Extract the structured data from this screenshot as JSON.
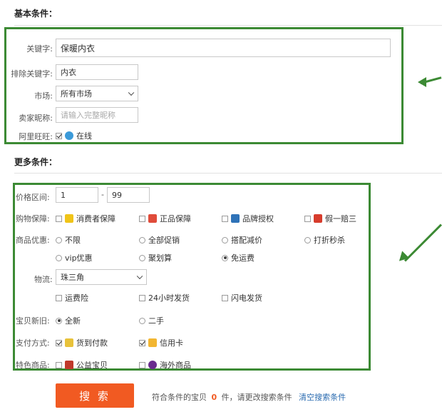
{
  "basic": {
    "title": "基本条件：",
    "keyword_label": "关键字:",
    "keyword_value": "保暖内衣",
    "exclude_label": "排除关键字:",
    "exclude_value": "内衣",
    "market_label": "市场:",
    "market_value": "所有市场",
    "seller_label": "卖家昵称:",
    "seller_placeholder": "请输入完整昵称",
    "wangwang_label": "阿里旺旺:",
    "wangwang_option": "在线"
  },
  "more": {
    "title": "更多条件：",
    "price_label": "价格区间:",
    "price_min": "1",
    "price_sep": "-",
    "price_max": "99",
    "guarantee_label": "购物保障:",
    "guarantee_options": [
      "消费者保障",
      "正品保障",
      "品牌授权",
      "假一赔三"
    ],
    "promo_label": "商品优惠:",
    "promo_row1": [
      "不限",
      "全部促销",
      "搭配减价",
      "打折秒杀"
    ],
    "promo_row2": [
      "vip优惠",
      "聚划算",
      "免运费"
    ],
    "logistics_label": "物流:",
    "logistics_value": "珠三角",
    "logistics_options": [
      "运费险",
      "24小时发货",
      "闪电发货"
    ],
    "condition_label": "宝贝新旧:",
    "condition_options": [
      "全新",
      "二手"
    ],
    "payment_label": "支付方式:",
    "payment_options": [
      "货到付款",
      "信用卡"
    ],
    "special_label": "特色商品:",
    "special_options": [
      "公益宝贝",
      "海外商品"
    ]
  },
  "footer": {
    "search_button": "搜 索",
    "result_prefix": "符合条件的宝贝",
    "result_count": "0",
    "result_suffix": "件，请更改搜索条件",
    "clear_link": "清空搜索条件"
  },
  "colors": {
    "highlight_box": "#3c8a34",
    "search_button": "#f15a22",
    "count": "#f15a22",
    "link": "#2a6bb0"
  }
}
